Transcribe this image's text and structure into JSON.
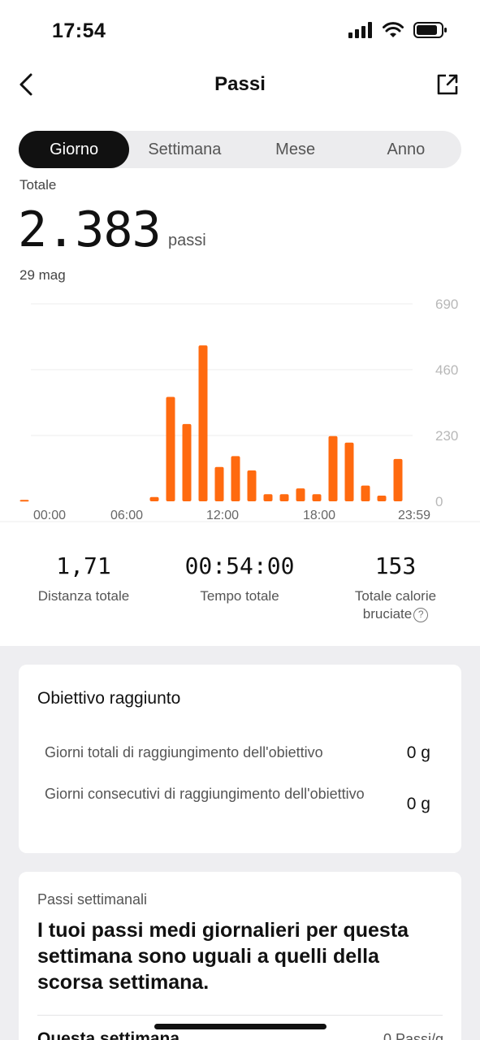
{
  "status_bar": {
    "time": "17:54"
  },
  "nav": {
    "title": "Passi"
  },
  "tabs": [
    {
      "label": "Giorno",
      "active": true
    },
    {
      "label": "Settimana",
      "active": false
    },
    {
      "label": "Mese",
      "active": false
    },
    {
      "label": "Anno",
      "active": false
    }
  ],
  "summary": {
    "total_label": "Totale",
    "total_value": "2.383",
    "unit": "passi",
    "date": "29 mag"
  },
  "chart_data": {
    "type": "bar",
    "x_tick_labels": [
      "00:00",
      "06:00",
      "12:00",
      "18:00",
      "23:59"
    ],
    "y_tick_labels": [
      "690",
      "460",
      "230",
      "0"
    ],
    "ylim": [
      0,
      690
    ],
    "grid": true,
    "bar_color": "#ff6a0f",
    "bins": 24,
    "values": [
      5,
      0,
      0,
      0,
      0,
      0,
      0,
      0,
      15,
      365,
      270,
      545,
      120,
      158,
      108,
      25,
      25,
      45,
      25,
      228,
      205,
      55,
      20,
      148
    ]
  },
  "metrics": [
    {
      "value": "1,71",
      "label": "Distanza totale"
    },
    {
      "value": "00:54:00",
      "label": "Tempo totale"
    },
    {
      "value": "153",
      "label_line1": "Totale calorie",
      "label_line2": "bruciate",
      "info_icon": "?"
    }
  ],
  "goal_card": {
    "title": "Obiettivo raggiunto",
    "rows": [
      {
        "label": "Giorni totali di raggiungimento dell'obiettivo",
        "value": "0 g"
      },
      {
        "label": "Giorni consecutivi di raggiungimento dell'obiettivo",
        "value": "0 g"
      }
    ]
  },
  "weekly_card": {
    "title": "Passi settimanali",
    "text": "I tuoi passi medi giornalieri per questa settimana sono uguali a quelli della scorsa settimana.",
    "more_left": "Questa settimana",
    "more_right": "0 Passi/g"
  },
  "colors": {
    "accent": "#ff6a0f",
    "tab_active_bg": "#111111",
    "page_gray": "#eeeef1"
  }
}
